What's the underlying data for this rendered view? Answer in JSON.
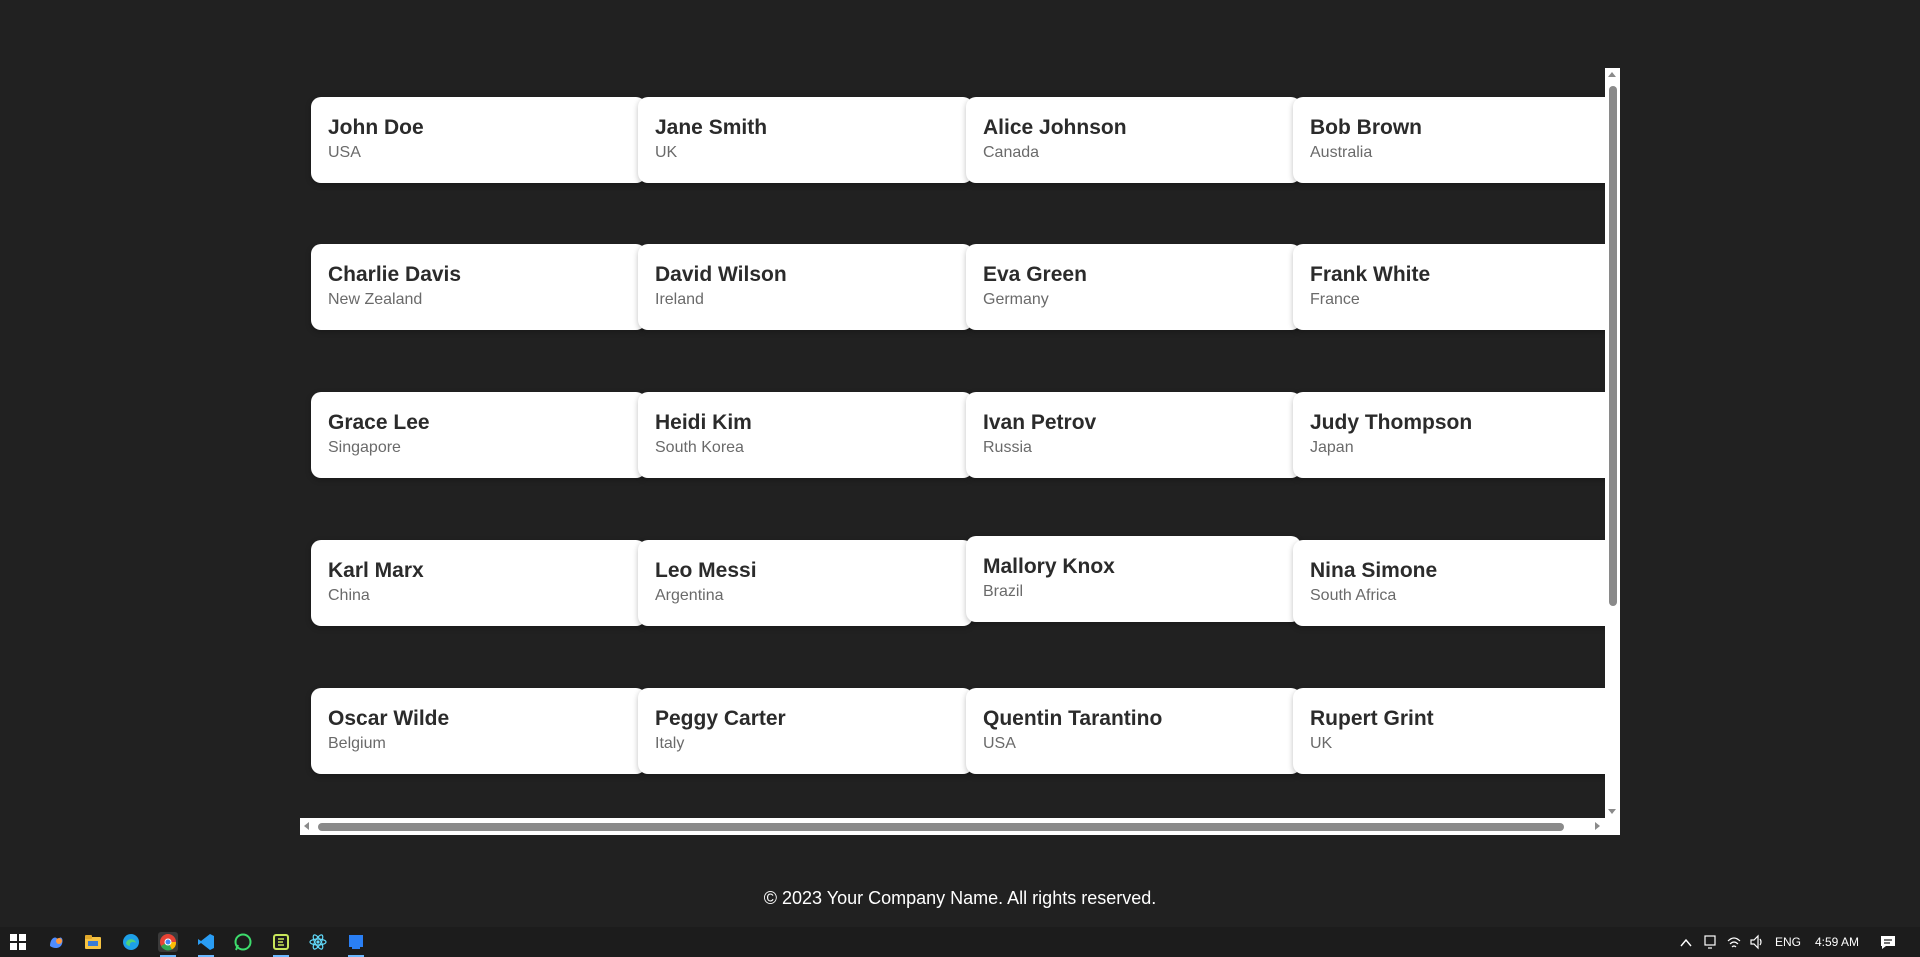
{
  "people": [
    {
      "name": "John Doe",
      "country": "USA"
    },
    {
      "name": "Jane Smith",
      "country": "UK"
    },
    {
      "name": "Alice Johnson",
      "country": "Canada"
    },
    {
      "name": "Bob Brown",
      "country": "Australia"
    },
    {
      "name": "Charlie Davis",
      "country": "New Zealand"
    },
    {
      "name": "David Wilson",
      "country": "Ireland"
    },
    {
      "name": "Eva Green",
      "country": "Germany"
    },
    {
      "name": "Frank White",
      "country": "France"
    },
    {
      "name": "Grace Lee",
      "country": "Singapore"
    },
    {
      "name": "Heidi Kim",
      "country": "South Korea"
    },
    {
      "name": "Ivan Petrov",
      "country": "Russia"
    },
    {
      "name": "Judy Thompson",
      "country": "Japan"
    },
    {
      "name": "Karl Marx",
      "country": "China"
    },
    {
      "name": "Leo Messi",
      "country": "Argentina"
    },
    {
      "name": "Mallory Knox",
      "country": "Brazil"
    },
    {
      "name": "Nina Simone",
      "country": "South Africa"
    },
    {
      "name": "Oscar Wilde",
      "country": "Belgium"
    },
    {
      "name": "Peggy Carter",
      "country": "Italy"
    },
    {
      "name": "Quentin Tarantino",
      "country": "USA"
    },
    {
      "name": "Rupert Grint",
      "country": "UK"
    }
  ],
  "footer": {
    "text": "© 2023 Your Company Name. All rights reserved."
  },
  "taskbar": {
    "apps": [
      "windows-start-icon",
      "copilot-icon",
      "file-explorer-icon",
      "edge-icon",
      "chrome-icon",
      "vscode-icon",
      "whatsapp-icon",
      "app-icon",
      "react-icon",
      "app-blue-icon"
    ],
    "language": "ENG",
    "time": "4:59 AM"
  }
}
